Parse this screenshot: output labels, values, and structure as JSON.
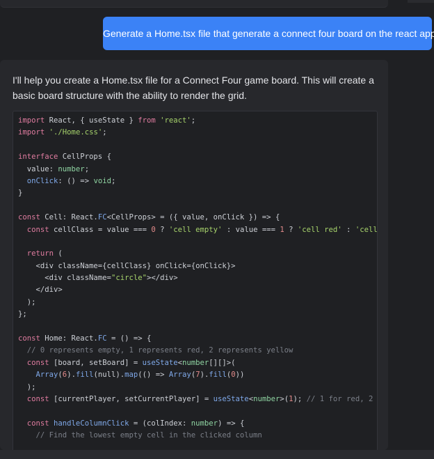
{
  "user_message": "Generate a Home.tsx file that generate a connect four board on the react app",
  "assistant_message": "I'll help you create a Home.tsx file for a Connect Four game board. This will create a basic board structure with the ability to render the grid.",
  "code_lines": [
    [
      [
        "kw",
        "import"
      ],
      [
        "p",
        " React, { useState } "
      ],
      [
        "kw",
        "from"
      ],
      [
        "p",
        " "
      ],
      [
        "str",
        "'react'"
      ],
      [
        "p",
        ";"
      ]
    ],
    [
      [
        "kw",
        "import"
      ],
      [
        "p",
        " "
      ],
      [
        "str",
        "'./Home.css'"
      ],
      [
        "p",
        ";"
      ]
    ],
    [],
    [
      [
        "kw",
        "interface"
      ],
      [
        "p",
        " CellProps {"
      ]
    ],
    [
      [
        "p",
        "  value: "
      ],
      [
        "ty",
        "number"
      ],
      [
        "p",
        ";"
      ]
    ],
    [
      [
        "p",
        "  "
      ],
      [
        "fn",
        "onClick"
      ],
      [
        "p",
        ": () => "
      ],
      [
        "ty",
        "void"
      ],
      [
        "p",
        ";"
      ]
    ],
    [
      [
        "p",
        "}"
      ]
    ],
    [],
    [
      [
        "kw",
        "const"
      ],
      [
        "p",
        " Cell: React."
      ],
      [
        "fn",
        "FC"
      ],
      [
        "p",
        "<CellProps> = ({ value, onClick }) => {"
      ]
    ],
    [
      [
        "p",
        "  "
      ],
      [
        "kw",
        "const"
      ],
      [
        "p",
        " cellClass = value === "
      ],
      [
        "num",
        "0"
      ],
      [
        "p",
        " ? "
      ],
      [
        "str",
        "'cell empty'"
      ],
      [
        "p",
        " : value === "
      ],
      [
        "num",
        "1"
      ],
      [
        "p",
        " ? "
      ],
      [
        "str",
        "'cell red'"
      ],
      [
        "p",
        " : "
      ],
      [
        "str",
        "'cell"
      ]
    ],
    [],
    [
      [
        "p",
        "  "
      ],
      [
        "kw",
        "return"
      ],
      [
        "p",
        " ("
      ]
    ],
    [
      [
        "p",
        "    <div className={cellClass} onClick={onClick}>"
      ]
    ],
    [
      [
        "p",
        "      <div className="
      ],
      [
        "str",
        "\"circle\""
      ],
      [
        "p",
        "></div>"
      ]
    ],
    [
      [
        "p",
        "    </div>"
      ]
    ],
    [
      [
        "p",
        "  );"
      ]
    ],
    [
      [
        "p",
        "};"
      ]
    ],
    [],
    [
      [
        "kw",
        "const"
      ],
      [
        "p",
        " Home: React."
      ],
      [
        "fn",
        "FC"
      ],
      [
        "p",
        " = () => {"
      ]
    ],
    [
      [
        "cm",
        "  // 0 represents empty, 1 represents red, 2 represents yellow"
      ]
    ],
    [
      [
        "p",
        "  "
      ],
      [
        "kw",
        "const"
      ],
      [
        "p",
        " [board, setBoard] = "
      ],
      [
        "fn",
        "useState"
      ],
      [
        "p",
        "<"
      ],
      [
        "ty",
        "number"
      ],
      [
        "p",
        "[][]>("
      ]
    ],
    [
      [
        "p",
        "    "
      ],
      [
        "fn",
        "Array"
      ],
      [
        "p",
        "("
      ],
      [
        "num",
        "6"
      ],
      [
        "p",
        ")."
      ],
      [
        "fn",
        "fill"
      ],
      [
        "p",
        "(null)."
      ],
      [
        "fn",
        "map"
      ],
      [
        "p",
        "(() => "
      ],
      [
        "fn",
        "Array"
      ],
      [
        "p",
        "("
      ],
      [
        "num",
        "7"
      ],
      [
        "p",
        ")."
      ],
      [
        "fn",
        "fill"
      ],
      [
        "p",
        "("
      ],
      [
        "num",
        "0"
      ],
      [
        "p",
        "))"
      ]
    ],
    [
      [
        "p",
        "  );"
      ]
    ],
    [
      [
        "p",
        "  "
      ],
      [
        "kw",
        "const"
      ],
      [
        "p",
        " [currentPlayer, setCurrentPlayer] = "
      ],
      [
        "fn",
        "useState"
      ],
      [
        "p",
        "<"
      ],
      [
        "ty",
        "number"
      ],
      [
        "p",
        ">("
      ],
      [
        "num",
        "1"
      ],
      [
        "p",
        "); "
      ],
      [
        "cm",
        "// 1 for red, 2"
      ]
    ],
    [],
    [
      [
        "p",
        "  "
      ],
      [
        "kw",
        "const"
      ],
      [
        "p",
        " "
      ],
      [
        "fn",
        "handleColumnClick"
      ],
      [
        "p",
        " = (colIndex: "
      ],
      [
        "ty",
        "number"
      ],
      [
        "p",
        ") => {"
      ]
    ],
    [
      [
        "cm",
        "    // Find the lowest empty cell in the clicked column"
      ]
    ]
  ]
}
